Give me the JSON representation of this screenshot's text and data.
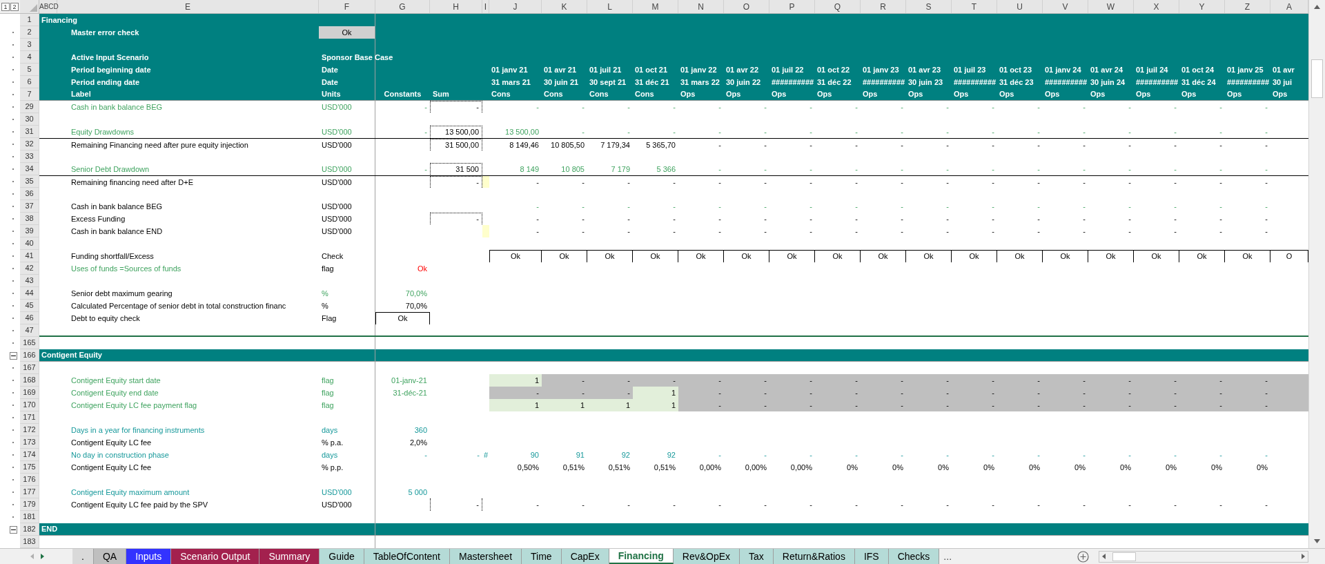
{
  "outline_levels": [
    "1",
    "2"
  ],
  "column_headers": [
    "A",
    "B",
    "C",
    "D",
    "E",
    "F",
    "G",
    "H",
    "I",
    "J",
    "K",
    "L",
    "M",
    "N",
    "O",
    "P",
    "Q",
    "R",
    "S",
    "T",
    "U",
    "V",
    "W",
    "X",
    "Y",
    "Z",
    "A"
  ],
  "rows": [
    {
      "num": "1",
      "kind": "section",
      "label": "Financing"
    },
    {
      "num": "2",
      "kind": "header",
      "grouped": true,
      "label": "Master error check",
      "units": "Ok",
      "units_button": true
    },
    {
      "num": "3",
      "kind": "header",
      "grouped": true
    },
    {
      "num": "4",
      "kind": "header",
      "grouped": true,
      "label": "Active Input Scenario",
      "units": "Sponsor Base Case"
    },
    {
      "num": "5",
      "kind": "header",
      "grouped": true,
      "label": "Period beginning date",
      "units": "Date",
      "periods": [
        "01 janv 21",
        "01 avr 21",
        "01 juil 21",
        "01 oct 21",
        "01 janv 22",
        "01 avr 22",
        "01 juil 22",
        "01 oct 22",
        "01 janv 23",
        "01 avr 23",
        "01 juil 23",
        "01 oct 23",
        "01 janv 24",
        "01 avr 24",
        "01 juil 24",
        "01 oct 24",
        "01 janv 25",
        "01 avr"
      ]
    },
    {
      "num": "6",
      "kind": "header",
      "grouped": true,
      "label": "Period ending date",
      "units": "Date",
      "periods": [
        "31 mars 21",
        "30 juin 21",
        "30 sept 21",
        "31 déc 21",
        "31 mars 22",
        "30 juin 22",
        "##########",
        "31 déc 22",
        "##########",
        "30 juin 23",
        "##########",
        "31 déc 23",
        "##########",
        "30 juin 24",
        "##########",
        "31 déc 24",
        "##########",
        "30 jui"
      ]
    },
    {
      "num": "7",
      "kind": "header",
      "grouped": true,
      "label": "Label",
      "units": "Units",
      "constants": "Constants",
      "sum": "Sum",
      "periods": [
        "Cons",
        "Cons",
        "Cons",
        "Cons",
        "Ops",
        "Ops",
        "Ops",
        "Ops",
        "Ops",
        "Ops",
        "Ops",
        "Ops",
        "Ops",
        "Ops",
        "Ops",
        "Ops",
        "Ops",
        "Ops"
      ]
    },
    {
      "num": "29",
      "kind": "input",
      "grouped": true,
      "label": {
        "text": "Cash in bank balance BEG",
        "kind": "input"
      },
      "units": {
        "text": "USD'000",
        "kind": "input"
      },
      "constants": {
        "text": "-",
        "kind": "input"
      },
      "sum": "-",
      "sum_boxed": true,
      "periods": [
        "-",
        "-",
        "-",
        "-",
        "-",
        "-",
        "-",
        "-",
        "-",
        "-",
        "-",
        "-",
        "-",
        "-",
        "-",
        "-",
        "-"
      ]
    },
    {
      "num": "30",
      "kind": "data",
      "grouped": true
    },
    {
      "num": "31",
      "kind": "input",
      "grouped": true,
      "label": {
        "text": "Equity  Drawdowns",
        "kind": "input"
      },
      "units": {
        "text": "USD'000",
        "kind": "input"
      },
      "constants": {
        "text": "-",
        "kind": "input"
      },
      "sum": "13 500,00",
      "sum_boxed": true,
      "periods": [
        "13 500,00",
        "-",
        "-",
        "-",
        "-",
        "-",
        "-",
        "-",
        "-",
        "-",
        "-",
        "-",
        "-",
        "-",
        "-",
        "-",
        "-"
      ]
    },
    {
      "num": "32",
      "kind": "data",
      "grouped": true,
      "rule_above": true,
      "label": "Remaining Financing need after pure equity injection",
      "units": "USD'000",
      "sum": "31 500,00",
      "sum_boxed": true,
      "periods": [
        "8 149,46",
        "10 805,50",
        "7 179,34",
        "5 365,70",
        "-",
        "-",
        "-",
        "-",
        "-",
        "-",
        "-",
        "-",
        "-",
        "-",
        "-",
        "-",
        "-"
      ]
    },
    {
      "num": "33",
      "kind": "data",
      "grouped": true
    },
    {
      "num": "34",
      "kind": "input",
      "grouped": true,
      "label": {
        "text": "Senior Debt Drawdown",
        "kind": "input"
      },
      "units": {
        "text": "USD'000",
        "kind": "input"
      },
      "constants": {
        "text": "-",
        "kind": "input"
      },
      "sum": "31 500",
      "sum_boxed": true,
      "periods": [
        "8 149",
        "10 805",
        "7 179",
        "5 366",
        "-",
        "-",
        "-",
        "-",
        "-",
        "-",
        "-",
        "-",
        "-",
        "-",
        "-",
        "-",
        "-"
      ]
    },
    {
      "num": "35",
      "kind": "data",
      "grouped": true,
      "rule_above": true,
      "label": "Remaining financing need after D+E",
      "units": "USD'000",
      "sum": "-",
      "sum_boxed": true,
      "col_i_fill": true,
      "periods": [
        "-",
        "-",
        "-",
        "-",
        "-",
        "-",
        "-",
        "-",
        "-",
        "-",
        "-",
        "-",
        "-",
        "-",
        "-",
        "-",
        "-"
      ]
    },
    {
      "num": "36",
      "kind": "data",
      "grouped": true
    },
    {
      "num": "37",
      "kind": "input",
      "grouped": true,
      "label": "Cash in bank balance BEG",
      "units": "USD'000",
      "periods": [
        "-",
        "-",
        "-",
        "-",
        "-",
        "-",
        "-",
        "-",
        "-",
        "-",
        "-",
        "-",
        "-",
        "-",
        "-",
        "-",
        "-"
      ]
    },
    {
      "num": "38",
      "kind": "data",
      "grouped": true,
      "label": "Excess Funding",
      "units": "USD'000",
      "sum": "-",
      "sum_boxed": true,
      "periods": [
        "-",
        "-",
        "-",
        "-",
        "-",
        "-",
        "-",
        "-",
        "-",
        "-",
        "-",
        "-",
        "-",
        "-",
        "-",
        "-",
        "-"
      ]
    },
    {
      "num": "39",
      "kind": "data",
      "grouped": true,
      "label": "Cash in bank balance END",
      "units": "USD'000",
      "col_i_fill": true,
      "periods": [
        "-",
        "-",
        "-",
        "-",
        "-",
        "-",
        "-",
        "-",
        "-",
        "-",
        "-",
        "-",
        "-",
        "-",
        "-",
        "-",
        "-"
      ]
    },
    {
      "num": "40",
      "kind": "data",
      "grouped": true
    },
    {
      "num": "41",
      "kind": "data",
      "grouped": true,
      "label": "Funding shortfall/Excess",
      "units": "Check",
      "period_box": true,
      "periods": [
        "Ok",
        "Ok",
        "Ok",
        "Ok",
        "Ok",
        "Ok",
        "Ok",
        "Ok",
        "Ok",
        "Ok",
        "Ok",
        "Ok",
        "Ok",
        "Ok",
        "Ok",
        "Ok",
        "Ok",
        "O"
      ]
    },
    {
      "num": "42",
      "kind": "data",
      "grouped": true,
      "label": {
        "text": "Uses of funds =Sources of funds",
        "kind": "input"
      },
      "units": "flag",
      "constants": {
        "text": "Ok",
        "kind": "alert"
      }
    },
    {
      "num": "43",
      "kind": "data",
      "grouped": true
    },
    {
      "num": "44",
      "kind": "data",
      "grouped": true,
      "label": "Senior debt maximum gearing",
      "units": {
        "text": "%",
        "kind": "input"
      },
      "constants": {
        "text": "70,0%",
        "kind": "input"
      }
    },
    {
      "num": "45",
      "kind": "data",
      "grouped": true,
      "label": "Calculated Percentage of senior debt in total construction financ",
      "units": "%",
      "constants": "70,0%"
    },
    {
      "num": "46",
      "kind": "data",
      "grouped": true,
      "label": "Debt to equity check",
      "units": "Flag",
      "constants": "Ok",
      "constants_box": true
    },
    {
      "num": "47",
      "kind": "data",
      "grouped": true,
      "rule_below": true
    },
    {
      "num": "165",
      "kind": "data",
      "grouped": true
    },
    {
      "num": "166",
      "kind": "section",
      "collapse": true,
      "label": "Contigent Equity"
    },
    {
      "num": "167",
      "kind": "data",
      "grouped": true
    },
    {
      "num": "168",
      "kind": "data",
      "grouped": true,
      "label": {
        "text": "Contigent Equity start date",
        "kind": "input"
      },
      "units": {
        "text": "flag",
        "kind": "input"
      },
      "constants": {
        "text": "01-janv-21",
        "kind": "input"
      },
      "periods": [
        {
          "text": "1",
          "on": true
        },
        {
          "text": "-",
          "on": false
        },
        {
          "text": "-",
          "on": false
        },
        {
          "text": "-",
          "on": false
        },
        {
          "text": "-",
          "on": false
        },
        {
          "text": "-",
          "on": false
        },
        {
          "text": "-",
          "on": false
        },
        {
          "text": "-",
          "on": false
        },
        {
          "text": "-",
          "on": false
        },
        {
          "text": "-",
          "on": false
        },
        {
          "text": "-",
          "on": false
        },
        {
          "text": "-",
          "on": false
        },
        {
          "text": "-",
          "on": false
        },
        {
          "text": "-",
          "on": false
        },
        {
          "text": "-",
          "on": false
        },
        {
          "text": "-",
          "on": false
        },
        {
          "text": "-",
          "on": false
        }
      ]
    },
    {
      "num": "169",
      "kind": "data",
      "grouped": true,
      "label": {
        "text": "Contigent Equity end date",
        "kind": "input"
      },
      "units": {
        "text": "flag",
        "kind": "input"
      },
      "constants": {
        "text": "31-déc-21",
        "kind": "input"
      },
      "periods": [
        {
          "text": "-",
          "on": false
        },
        {
          "text": "-",
          "on": false
        },
        {
          "text": "-",
          "on": false
        },
        {
          "text": "1",
          "on": true
        },
        {
          "text": "-",
          "on": false
        },
        {
          "text": "-",
          "on": false
        },
        {
          "text": "-",
          "on": false
        },
        {
          "text": "-",
          "on": false
        },
        {
          "text": "-",
          "on": false
        },
        {
          "text": "-",
          "on": false
        },
        {
          "text": "-",
          "on": false
        },
        {
          "text": "-",
          "on": false
        },
        {
          "text": "-",
          "on": false
        },
        {
          "text": "-",
          "on": false
        },
        {
          "text": "-",
          "on": false
        },
        {
          "text": "-",
          "on": false
        },
        {
          "text": "-",
          "on": false
        }
      ]
    },
    {
      "num": "170",
      "kind": "data",
      "grouped": true,
      "label": {
        "text": "Contigent Equity LC fee payment flag",
        "kind": "input"
      },
      "units": {
        "text": "flag",
        "kind": "input"
      },
      "periods": [
        {
          "text": "1",
          "on": true
        },
        {
          "text": "1",
          "on": true
        },
        {
          "text": "1",
          "on": true
        },
        {
          "text": "1",
          "on": true
        },
        {
          "text": "-",
          "on": false
        },
        {
          "text": "-",
          "on": false
        },
        {
          "text": "-",
          "on": false
        },
        {
          "text": "-",
          "on": false
        },
        {
          "text": "-",
          "on": false
        },
        {
          "text": "-",
          "on": false
        },
        {
          "text": "-",
          "on": false
        },
        {
          "text": "-",
          "on": false
        },
        {
          "text": "-",
          "on": false
        },
        {
          "text": "-",
          "on": false
        },
        {
          "text": "-",
          "on": false
        },
        {
          "text": "-",
          "on": false
        },
        {
          "text": "-",
          "on": false
        }
      ]
    },
    {
      "num": "171",
      "kind": "data",
      "grouped": true
    },
    {
      "num": "172",
      "kind": "data",
      "grouped": true,
      "label": {
        "text": "Days in a year for financing instruments",
        "kind": "link"
      },
      "units": {
        "text": "days",
        "kind": "link"
      },
      "constants": {
        "text": "360",
        "kind": "link"
      }
    },
    {
      "num": "173",
      "kind": "data",
      "grouped": true,
      "label": "Contigent Equity LC fee",
      "units": "% p.a.",
      "constants": "2,0%"
    },
    {
      "num": "174",
      "kind": "link",
      "grouped": true,
      "label": {
        "text": "No day in construction phase",
        "kind": "link"
      },
      "units": {
        "text": "days",
        "kind": "link"
      },
      "constants": {
        "text": "-",
        "kind": "link"
      },
      "sum": "-",
      "col_i": "#",
      "periods": [
        "90",
        "91",
        "92",
        "92",
        "-",
        "-",
        "-",
        "-",
        "-",
        "-",
        "-",
        "-",
        "-",
        "-",
        "-",
        "-",
        "-"
      ]
    },
    {
      "num": "175",
      "kind": "data",
      "grouped": true,
      "label": "Contigent Equity LC fee",
      "units": "% p.p.",
      "periods": [
        "0,50%",
        "0,51%",
        "0,51%",
        "0,51%",
        "0,00%",
        "0,00%",
        "0,00%",
        "0%",
        "0%",
        "0%",
        "0%",
        "0%",
        "0%",
        "0%",
        "0%",
        "0%",
        "0%"
      ]
    },
    {
      "num": "176",
      "kind": "data",
      "grouped": true
    },
    {
      "num": "177",
      "kind": "data",
      "grouped": true,
      "label": {
        "text": "Contigent Equity maximum amount",
        "kind": "link"
      },
      "units": {
        "text": "USD'000",
        "kind": "link"
      },
      "constants": {
        "text": "5 000",
        "kind": "link"
      }
    },
    {
      "num": "179",
      "kind": "data",
      "grouped": true,
      "label": "Contigent Equity LC fee paid by the SPV",
      "units": "USD'000",
      "sum": "-",
      "sum_dotted_sides": true,
      "periods": [
        "-",
        "-",
        "-",
        "-",
        "-",
        "-",
        "-",
        "-",
        "-",
        "-",
        "-",
        "-",
        "-",
        "-",
        "-",
        "-",
        "-"
      ]
    },
    {
      "num": "181",
      "kind": "data",
      "grouped": true
    },
    {
      "num": "182",
      "kind": "section",
      "collapse": true,
      "label": "END"
    },
    {
      "num": "183",
      "kind": "data"
    }
  ],
  "tabs": [
    {
      "label": ".",
      "color": "#d9d9d9",
      "selected": false
    },
    {
      "label": "QA",
      "color": "#bfbfbf",
      "selected": false
    },
    {
      "label": "Inputs",
      "color": "#3333ff",
      "selected": false
    },
    {
      "label": "Scenario Output",
      "color": "#a3214e",
      "selected": false
    },
    {
      "label": "Summary",
      "color": "#a3214e",
      "selected": false
    },
    {
      "label": "Guide",
      "color": "#b5dbd7",
      "selected": false
    },
    {
      "label": "TableOfContent",
      "color": "#b5dbd7",
      "selected": false
    },
    {
      "label": "Mastersheet",
      "color": "#b5dbd7",
      "selected": false
    },
    {
      "label": "Time",
      "color": "#b5dbd7",
      "selected": false
    },
    {
      "label": "CapEx",
      "color": "#b5dbd7",
      "selected": false
    },
    {
      "label": "Financing",
      "selected": true
    },
    {
      "label": "Rev&OpEx",
      "color": "#b5dbd7",
      "selected": false
    },
    {
      "label": "Tax",
      "color": "#b5dbd7",
      "selected": false
    },
    {
      "label": "Return&Ratios",
      "color": "#b5dbd7",
      "selected": false
    },
    {
      "label": "IFS",
      "color": "#b5dbd7",
      "selected": false
    },
    {
      "label": "Checks",
      "color": "#b5dbd7",
      "selected": false
    }
  ],
  "more_tabs": "..."
}
